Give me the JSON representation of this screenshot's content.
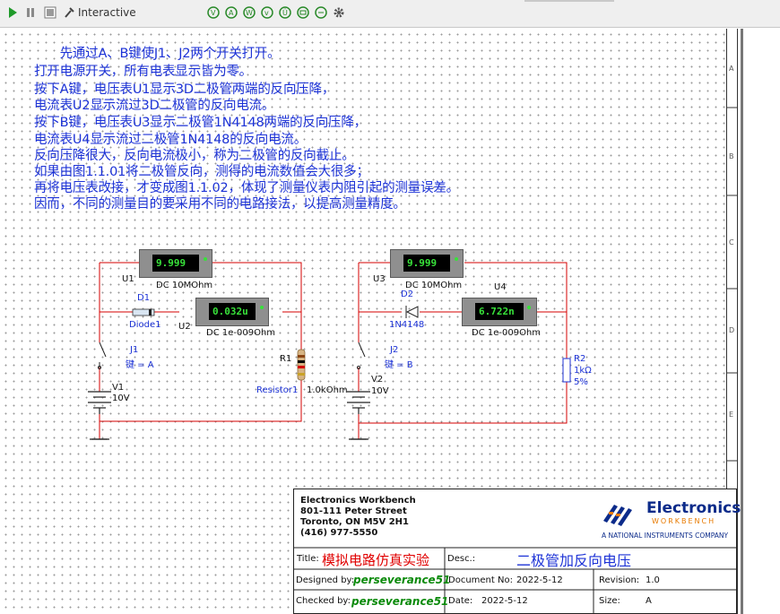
{
  "toolbar": {
    "mode_label": "Interactive"
  },
  "notes": [
    "　　先通过A、B键使J1、J2两个开关打开。",
    "打开电源开关，所有电表显示皆为零。",
    "按下A键，电压表U1显示3D二极管两端的反向压降，",
    "电流表U2显示流过3D二极管的反向电流。",
    "按下B键，电压表U3显示二极管1N4148两端的反向压降，",
    "电流表U4显示流过二极管1N4148的反向电流。",
    "反向压降很大，反向电流极小，称为二极管的反向截止。",
    "如果由图1.1.01将二极管反向，测得的电流数值会大很多；",
    "再将电压表改接，才变成图1.1.02，体现了测量仪表内阻引起的测量误差。",
    "因而，不同的测量目的要采用不同的电路接法，以提高测量精度。"
  ],
  "circuit1": {
    "u1": {
      "name": "U1",
      "value": "9.999",
      "spec": "DC  10MOhm"
    },
    "u2": {
      "name": "U2",
      "value": "0.032u",
      "spec": "DC  1e-009Ohm"
    },
    "d1": {
      "name": "D1",
      "part": "Diode1"
    },
    "j1": {
      "name": "J1",
      "key": "键 = A"
    },
    "r1": {
      "name": "R1",
      "part": "Resistor1",
      "value": "1.0kOhm"
    },
    "v1": {
      "name": "V1",
      "value": "10V"
    }
  },
  "circuit2": {
    "u3": {
      "name": "U3",
      "value": "9.999",
      "spec": "DC  10MOhm"
    },
    "u4": {
      "name": "U4",
      "value": "6.722n",
      "spec": "DC  1e-009Ohm"
    },
    "d2": {
      "name": "D2",
      "part": "1N4148"
    },
    "j2": {
      "name": "J2",
      "key": "键 = B"
    },
    "r2": {
      "name": "R2",
      "value": "1kΩ",
      "tolerance": "5%"
    },
    "v2": {
      "name": "V2",
      "value": "10V"
    }
  },
  "title_block": {
    "company": "Electronics Workbench",
    "address1": "801-111 Peter Street",
    "address2": "Toronto, ON M5V 2H1",
    "phone": "(416) 977-5550",
    "logo_main": "Electronics",
    "logo_sub": "WORKBENCH",
    "logo_tag": "A NATIONAL INSTRUMENTS COMPANY",
    "title_label": "Title:",
    "title_value": "模拟电路仿真实验",
    "desc_label": "Desc.:",
    "desc_value": "二极管加反向电压",
    "designed_label": "Designed by:",
    "designed_value": "perseverance51",
    "docno_label": "Document No:",
    "docno_value": "2022-5-12",
    "revision_label": "Revision:",
    "revision_value": "1.0",
    "checked_label": "Checked by:",
    "checked_value": "perseverance51",
    "date_label": "Date:",
    "date_value": "2022-5-12",
    "size_label": "Size:",
    "size_value": "A"
  },
  "ruler_letters": [
    "A",
    "B",
    "C",
    "D",
    "E"
  ],
  "colors": {
    "wire": "#d40000",
    "note_text": "#1c32d6",
    "meter_display": "#38e23a",
    "title_red": "#e00000",
    "signature_green": "#0a8a0a"
  }
}
